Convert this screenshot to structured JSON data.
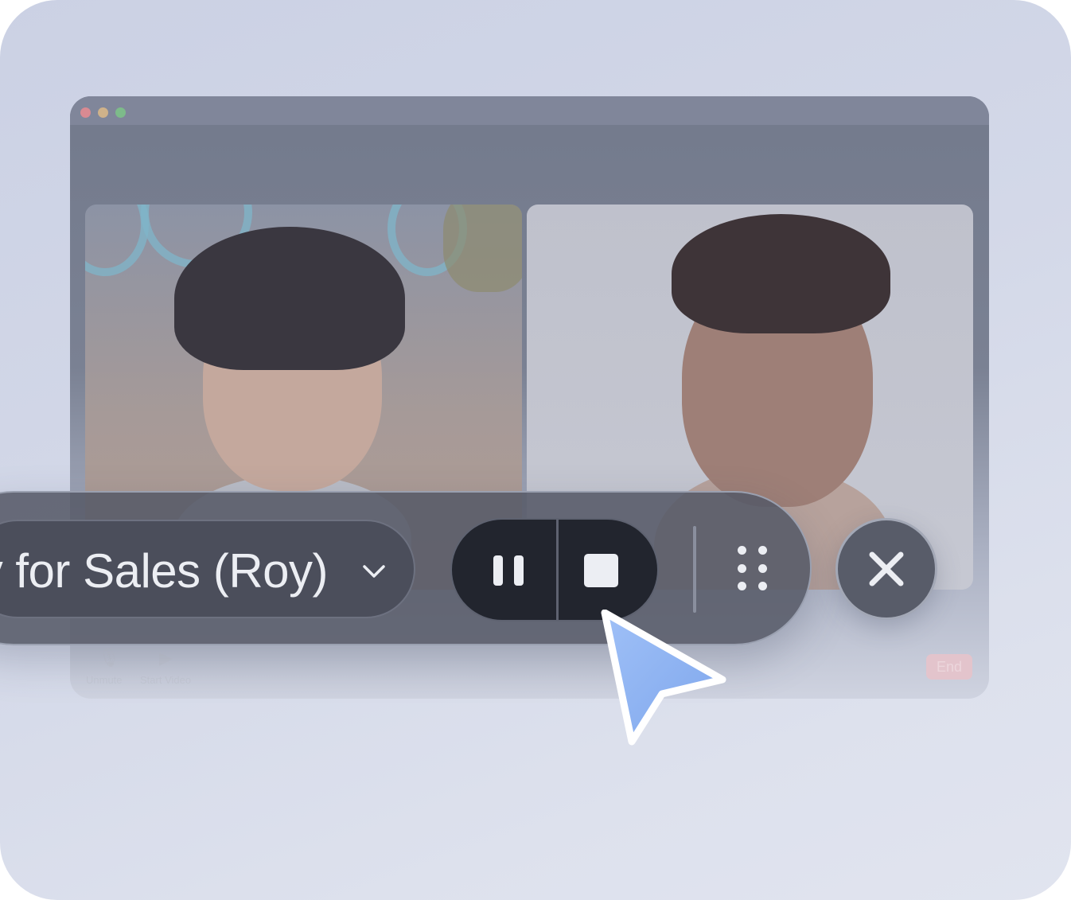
{
  "meeting": {
    "controls": {
      "mute_label": "Unmute",
      "video_label": "Start Video",
      "end_label": "End"
    }
  },
  "recorder": {
    "session_label": "y for Sales (Roy)",
    "pause_icon": "pause-icon",
    "stop_icon": "stop-icon",
    "drag_icon": "drag-handle-icon",
    "close_icon": "close-icon"
  },
  "colors": {
    "accent_cursor": "#8fb0f0",
    "toolbar_bg": "#565a68",
    "button_dark": "#22252e"
  }
}
